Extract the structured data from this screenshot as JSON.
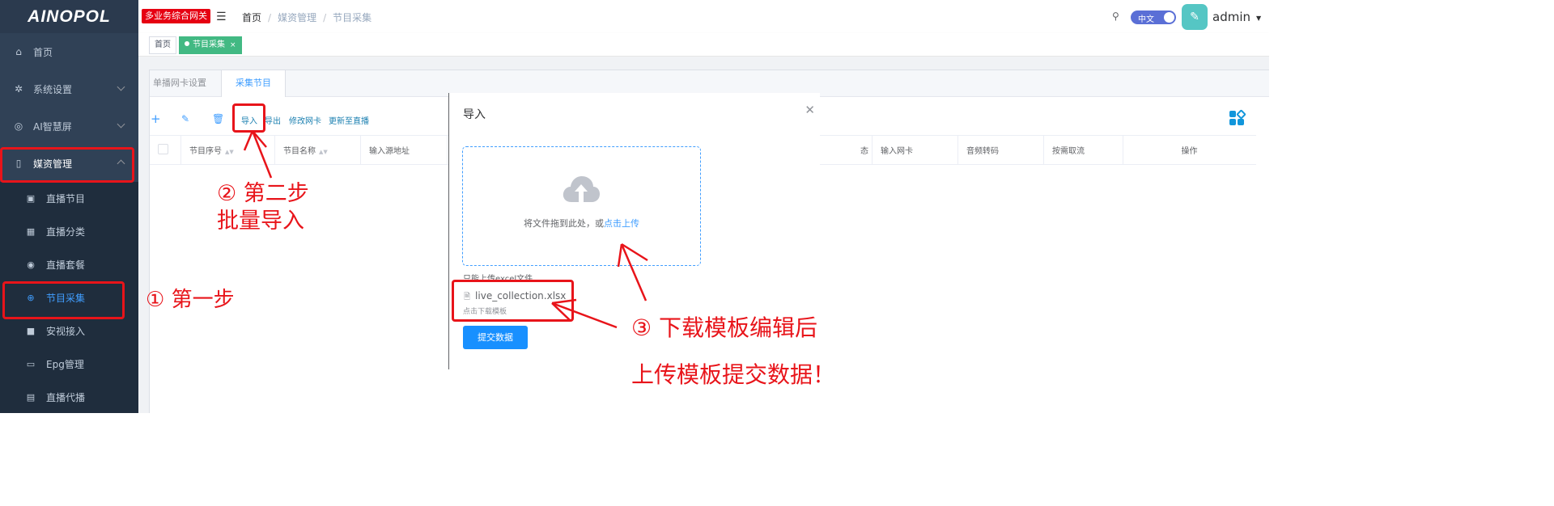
{
  "brand": {
    "logo": "AINOPOL",
    "badge": "多业务综合网关"
  },
  "sidebar": {
    "items": [
      {
        "label": "首页",
        "icon": "home-icon"
      },
      {
        "label": "系统设置",
        "icon": "gears-icon"
      },
      {
        "label": "AI智慧屏",
        "icon": "ai-icon"
      },
      {
        "label": "媒资管理",
        "icon": "media-icon",
        "expanded": true
      }
    ],
    "sub_items": [
      {
        "label": "直播节目",
        "icon": "tv-icon"
      },
      {
        "label": "直播分类",
        "icon": "category-icon"
      },
      {
        "label": "直播套餐",
        "icon": "package-icon"
      },
      {
        "label": "节目采集",
        "icon": "globe-icon",
        "active": true
      },
      {
        "label": "安视接入",
        "icon": "camera-icon"
      },
      {
        "label": "Epg管理",
        "icon": "epg-icon"
      },
      {
        "label": "直播代播",
        "icon": "relay-icon"
      }
    ]
  },
  "header": {
    "breadcrumb": [
      "首页",
      "媒资管理",
      "节目采集"
    ],
    "lang": "中文",
    "user": "admin"
  },
  "tags": {
    "home": "首页",
    "current": "节目采集"
  },
  "tabs": [
    "单播网卡设置",
    "采集节目"
  ],
  "toolbar": {
    "import": "导入",
    "export": "导出",
    "modify_nic": "修改网卡",
    "update_live": "更新至直播"
  },
  "table": {
    "columns_left": [
      "节目序号",
      "节目名称",
      "输入源地址"
    ],
    "columns_right_partial": "态",
    "columns_right": [
      "输入网卡",
      "音频转码",
      "按需取流",
      "操作"
    ]
  },
  "dialog": {
    "title": "导入",
    "drop_text": "将文件拖到此处，或",
    "click_upload": "点击上传",
    "tip": "只能上传excel文件",
    "file_name": "live_collection.xlsx",
    "template_link": "点击下载模板",
    "submit": "提交数据"
  },
  "annotations": {
    "step1": "① 第一步",
    "step2_line1": "② 第二步",
    "step2_line2": "批量导入",
    "step3_line1": "③ 下载模板编辑后",
    "step3_line2": "上传模板提交数据！",
    "color": "#e8141a"
  }
}
